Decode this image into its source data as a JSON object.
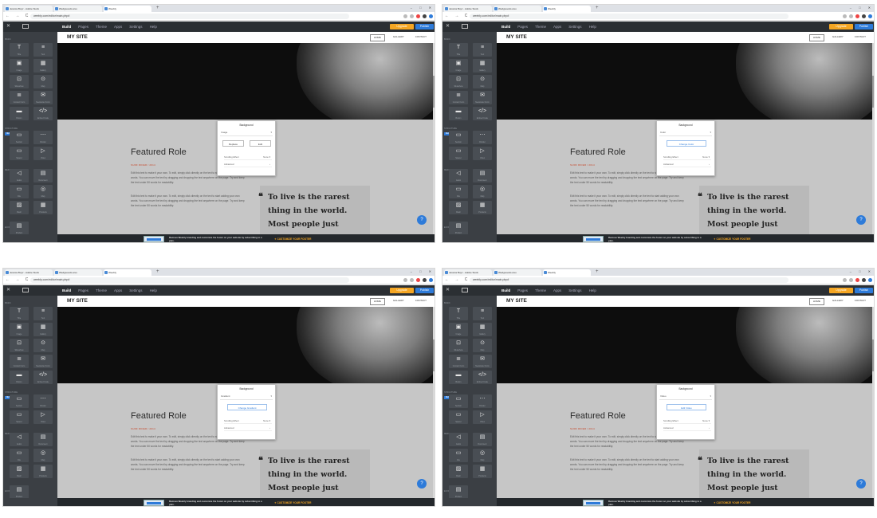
{
  "browser": {
    "tabs": [
      "Jessica Boyz - Adobe Stock",
      "Wedgwoods.wsu",
      "Weebly"
    ],
    "new_tab": "+",
    "url": "weebly.com/editor/main.php#",
    "window_controls": "– □ ✕",
    "nav": "← → C"
  },
  "editor": {
    "close": "✕",
    "menu": [
      "Build",
      "Pages",
      "Theme",
      "Apps",
      "Settings",
      "Help"
    ],
    "upgrade": "Upgrade",
    "publish": "Publish"
  },
  "sidebar": {
    "sections": [
      "BASIC",
      "STRUCTURE",
      "MEDIA",
      "ECOMMERCE"
    ],
    "new_badge": "NEW",
    "tiles": [
      {
        "icon": "T",
        "label": "Title"
      },
      {
        "icon": "≡",
        "label": "Text"
      },
      {
        "icon": "▣",
        "label": "Image"
      },
      {
        "icon": "▦",
        "label": "Gallery"
      },
      {
        "icon": "⊡",
        "label": "Slideshow"
      },
      {
        "icon": "⊙",
        "label": "Map"
      },
      {
        "icon": "≣",
        "label": "Contact Form"
      },
      {
        "icon": "✉",
        "label": "Newsletter Form"
      },
      {
        "icon": "▬",
        "label": "Button"
      },
      {
        "icon": "</>",
        "label": "Embed Code"
      },
      {
        "icon": "▭",
        "label": "Section"
      },
      {
        "icon": "⋯",
        "label": "Divider"
      },
      {
        "icon": "▭",
        "label": "Spacer"
      },
      {
        "icon": "▷",
        "label": "Video"
      },
      {
        "icon": "◁",
        "label": "Audio"
      },
      {
        "icon": "▤",
        "label": "Document"
      },
      {
        "icon": "▭",
        "label": "File"
      },
      {
        "icon": "◎",
        "label": "Map"
      },
      {
        "icon": "▨",
        "label": "Flash"
      },
      {
        "icon": "▦",
        "label": "Products"
      },
      {
        "icon": "▤",
        "label": "Product"
      }
    ]
  },
  "site": {
    "title": "MY SITE",
    "nav": [
      "HOME",
      "GALLERY",
      "CONTACT"
    ],
    "featured_title": "Featured Role",
    "featured_sub": "SURF RIDER / 2014",
    "para1": "Edit this text to make it your own. To edit, simply click directly on the text to start adding your own words. You can move the text by dragging and dropping the text anywhere on the page. Try and keep the text under 50 words for readability.",
    "para2": "Edit this text to make it your own. To edit, simply click directly on the text to start adding your own words. You can move the text by dragging and dropping the text anywhere on the page. Try and keep the text under 50 words for readability.",
    "quote_mark": "❝",
    "quote": [
      "To live is the rarest",
      "thing in the world.",
      "Most people just"
    ],
    "help": "?"
  },
  "footer": {
    "text": "Remove Weebly branding and customize the footer on your website by subscribing to a plan.",
    "cta": "✦ CUSTOMIZE YOUR FOOTER"
  },
  "panels": [
    {
      "title": "Background",
      "type_label": "Image",
      "buttons": [
        "Replace",
        "Edit"
      ],
      "rows": [
        {
          "label": "Scrolling Effect",
          "value": "None ▾"
        },
        {
          "label": "Advanced",
          "value": "›"
        }
      ]
    },
    {
      "title": "Background",
      "type_label": "Color",
      "buttons": [
        "Change Color"
      ],
      "rows": [
        {
          "label": "Scrolling Effect",
          "value": "None ▾"
        },
        {
          "label": "Advanced",
          "value": "›"
        }
      ]
    },
    {
      "title": "Background",
      "type_label": "Gradient",
      "buttons": [
        "Change Gradient"
      ],
      "rows": [
        {
          "label": "Scrolling Effect",
          "value": "None ▾"
        },
        {
          "label": "Advanced",
          "value": "›"
        }
      ]
    },
    {
      "title": "Background",
      "type_label": "Video",
      "buttons": [
        "Edit Video"
      ],
      "rows": [
        {
          "label": "Scrolling Effect",
          "value": "None ▾"
        },
        {
          "label": "Advanced",
          "value": "›"
        }
      ]
    }
  ],
  "colors": {
    "accent": "#2e7bd9",
    "upgrade": "#f5a623",
    "editor_bg": "#2b2f33",
    "panel_bg": "#3b3f44"
  }
}
